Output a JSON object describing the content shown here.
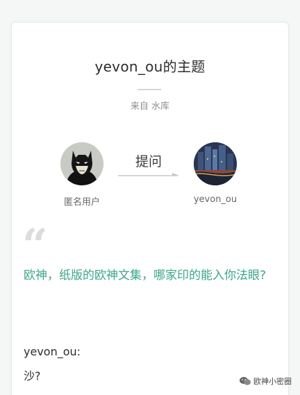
{
  "header": {
    "title": "yevon_ou的主题",
    "source": "来自 水库"
  },
  "exchange": {
    "asker_name": "匿名用户",
    "ask_label": "提问",
    "answerer_name": "yevon_ou"
  },
  "question": {
    "text": "欧神，纸版的欧神文集，哪家印的能入你法眼?"
  },
  "answer": {
    "user": "yevon_ou:",
    "text": "沙?"
  },
  "watermark": {
    "text": "欧神小密圈",
    "icon": "wechat-icon"
  },
  "colors": {
    "question_text": "#3aa58a",
    "quote_mark": "#dcdcdc"
  }
}
